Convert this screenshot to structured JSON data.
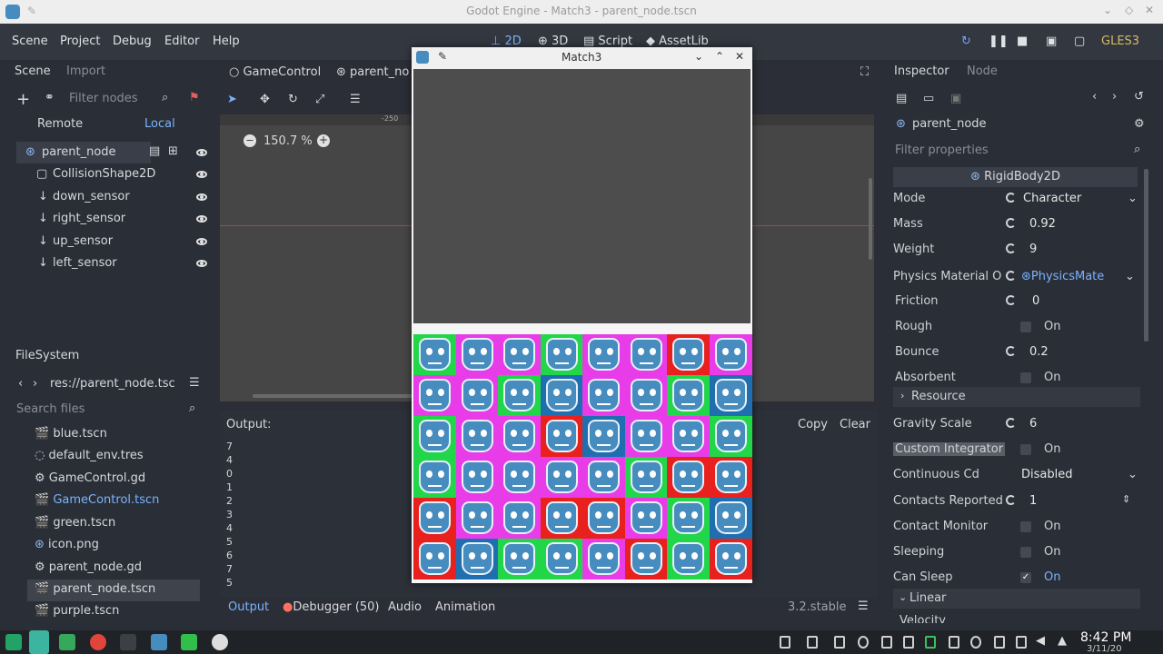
{
  "window": {
    "title": "Godot Engine - Match3 - parent_node.tscn"
  },
  "menu": {
    "items": [
      "Scene",
      "Project",
      "Debug",
      "Editor",
      "Help"
    ],
    "workspaces": [
      "2D",
      "3D",
      "Script",
      "AssetLib"
    ],
    "renderer": "GLES3"
  },
  "scene_dock": {
    "tabs": [
      "Scene",
      "Import"
    ],
    "filter_placeholder": "Filter nodes",
    "remote": "Remote",
    "local": "Local",
    "tree": [
      {
        "name": "parent_node",
        "icon": "rigidbody-icon"
      },
      {
        "name": "CollisionShape2D",
        "icon": "collision-icon"
      },
      {
        "name": "down_sensor",
        "icon": "raycast-icon"
      },
      {
        "name": "right_sensor",
        "icon": "raycast-icon"
      },
      {
        "name": "up_sensor",
        "icon": "raycast-icon"
      },
      {
        "name": "left_sensor",
        "icon": "raycast-icon"
      }
    ]
  },
  "filesystem": {
    "title": "FileSystem",
    "path": "res://parent_node.tsc",
    "search_placeholder": "Search files",
    "files": [
      "blue.tscn",
      "default_env.tres",
      "GameControl.gd",
      "GameControl.tscn",
      "green.tscn",
      "icon.png",
      "parent_node.gd",
      "parent_node.tscn",
      "purple.tscn"
    ],
    "highlighted": "GameControl.tscn",
    "selected": "parent_node.tscn"
  },
  "editor": {
    "tabs": [
      "GameControl",
      "parent_no"
    ],
    "zoom": "150.7 %",
    "ruler_mark": "-250"
  },
  "output": {
    "label": "Output:",
    "lines": [
      "7",
      "4",
      "0",
      "1",
      "2",
      "3",
      "4",
      "5",
      "6",
      "7",
      "5"
    ],
    "copy": "Copy",
    "clear": "Clear",
    "bottom_tabs": [
      "Output",
      "Debugger (50)",
      "Audio",
      "Animation"
    ],
    "version": "3.2.stable"
  },
  "game_window": {
    "title": "Match3",
    "grid": [
      [
        "green",
        "magenta",
        "magenta",
        "green",
        "magenta",
        "magenta",
        "red",
        "magenta"
      ],
      [
        "magenta",
        "magenta",
        "green",
        "blue",
        "magenta",
        "magenta",
        "green",
        "blue"
      ],
      [
        "green",
        "magenta",
        "magenta",
        "red",
        "blue",
        "magenta",
        "magenta",
        "green"
      ],
      [
        "green",
        "magenta",
        "magenta",
        "magenta",
        "magenta",
        "green",
        "red",
        "red"
      ],
      [
        "red",
        "magenta",
        "magenta",
        "red",
        "red",
        "magenta",
        "green",
        "blue"
      ],
      [
        "red",
        "blue",
        "green",
        "green",
        "magenta",
        "red",
        "green",
        "red"
      ]
    ],
    "colors": {
      "green": "#22d64a",
      "magenta": "#e83ce8",
      "red": "#e8201e",
      "blue": "#1f6fb0"
    }
  },
  "inspector": {
    "tabs": [
      "Inspector",
      "Node"
    ],
    "node": "parent_node",
    "filter_placeholder": "Filter properties",
    "class": "RigidBody2D",
    "rows": [
      {
        "label": "Mode",
        "value": "Character",
        "type": "dropdown",
        "reset": true
      },
      {
        "label": "Mass",
        "value": "0.92",
        "type": "field",
        "reset": true
      },
      {
        "label": "Weight",
        "value": "9",
        "type": "field",
        "reset": true
      },
      {
        "label": "Physics Material O",
        "value": "PhysicsMate",
        "type": "resource",
        "reset": true
      },
      {
        "label": "Friction",
        "value": "0",
        "type": "field",
        "reset": true
      },
      {
        "label": "Rough",
        "value": "On",
        "type": "check",
        "checked": false
      },
      {
        "label": "Bounce",
        "value": "0.2",
        "type": "field",
        "reset": true
      },
      {
        "label": "Absorbent",
        "value": "On",
        "type": "check",
        "checked": false
      },
      {
        "label": "Resource",
        "value": "",
        "type": "section"
      },
      {
        "label": "Gravity Scale",
        "value": "6",
        "type": "field",
        "reset": true
      },
      {
        "label": "Custom Integrator",
        "value": "On",
        "type": "check",
        "checked": false
      },
      {
        "label": "Continuous Cd",
        "value": "Disabled",
        "type": "dropdown"
      },
      {
        "label": "Contacts Reported",
        "value": "1",
        "type": "spin",
        "reset": true
      },
      {
        "label": "Contact Monitor",
        "value": "On",
        "type": "check",
        "checked": false
      },
      {
        "label": "Sleeping",
        "value": "On",
        "type": "check",
        "checked": false
      },
      {
        "label": "Can Sleep",
        "value": "On",
        "type": "check",
        "checked": true
      }
    ],
    "linear_section": "Linear",
    "partial_row": "Velocity"
  },
  "taskbar": {
    "time": "8:42 PM",
    "date": "3/11/20"
  }
}
